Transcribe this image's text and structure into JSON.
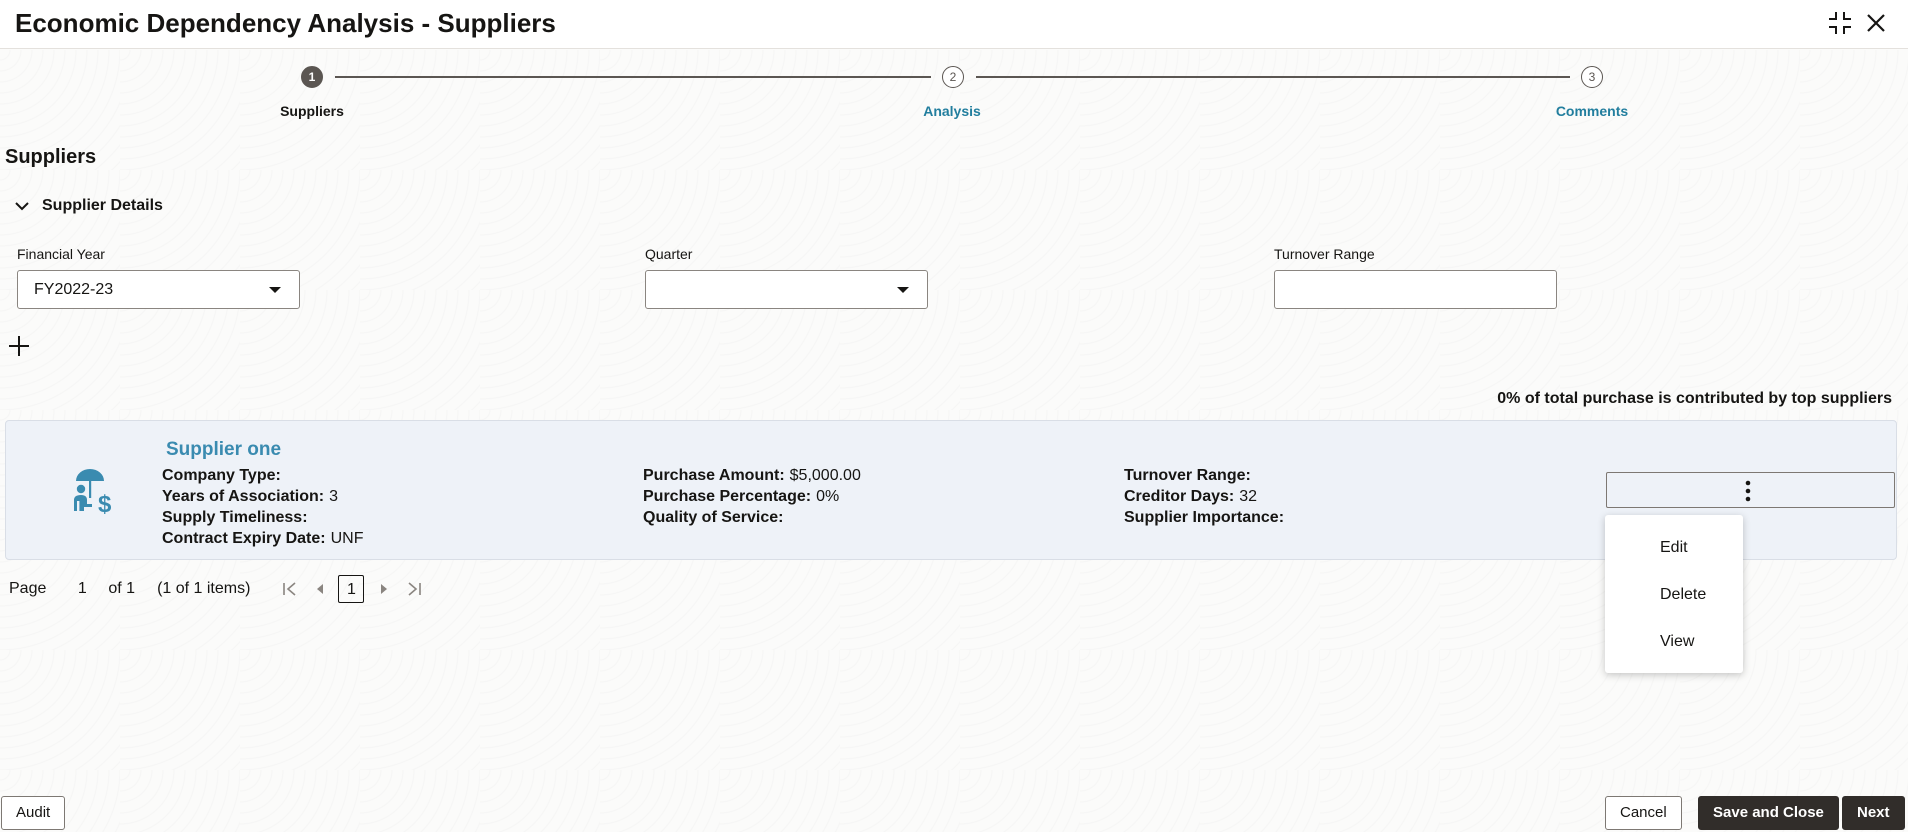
{
  "header": {
    "title": "Economic Dependency Analysis - Suppliers"
  },
  "stepper": {
    "steps": [
      {
        "number": "1",
        "label": "Suppliers"
      },
      {
        "number": "2",
        "label": "Analysis"
      },
      {
        "number": "3",
        "label": "Comments"
      }
    ]
  },
  "section": {
    "title": "Suppliers",
    "subsection_title": "Supplier Details"
  },
  "filters": {
    "financial_year": {
      "label": "Financial Year",
      "value": "FY2022-23"
    },
    "quarter": {
      "label": "Quarter",
      "value": ""
    },
    "turnover_range": {
      "label": "Turnover Range",
      "value": ""
    }
  },
  "summary": "0% of total purchase is contributed by top suppliers",
  "supplier": {
    "name": "Supplier one",
    "col1": [
      {
        "key": "Company Type:",
        "value": ""
      },
      {
        "key": "Years of Association:",
        "value": "3"
      },
      {
        "key": "Supply Timeliness:",
        "value": ""
      },
      {
        "key": "Contract Expiry Date:",
        "value": "UNF"
      }
    ],
    "col2": [
      {
        "key": "Purchase Amount:",
        "value": "$5,000.00"
      },
      {
        "key": "Purchase Percentage:",
        "value": "0%"
      },
      {
        "key": "Quality of Service:",
        "value": ""
      }
    ],
    "col3": [
      {
        "key": "Turnover Range:",
        "value": ""
      },
      {
        "key": "Creditor Days:",
        "value": "32"
      },
      {
        "key": "Supplier Importance:",
        "value": ""
      }
    ]
  },
  "menu": {
    "items": [
      "Edit",
      "Delete",
      "View"
    ]
  },
  "pager": {
    "page_label": "Page",
    "page_value": "1",
    "of_label": "of 1",
    "items_label": "(1 of 1 items)",
    "current": "1"
  },
  "footer": {
    "audit": "Audit",
    "cancel": "Cancel",
    "save_close": "Save and Close",
    "next": "Next"
  },
  "colors": {
    "accent": "#227e9e",
    "primary_button": "#312d2a",
    "card_bg": "#eef2f8"
  }
}
